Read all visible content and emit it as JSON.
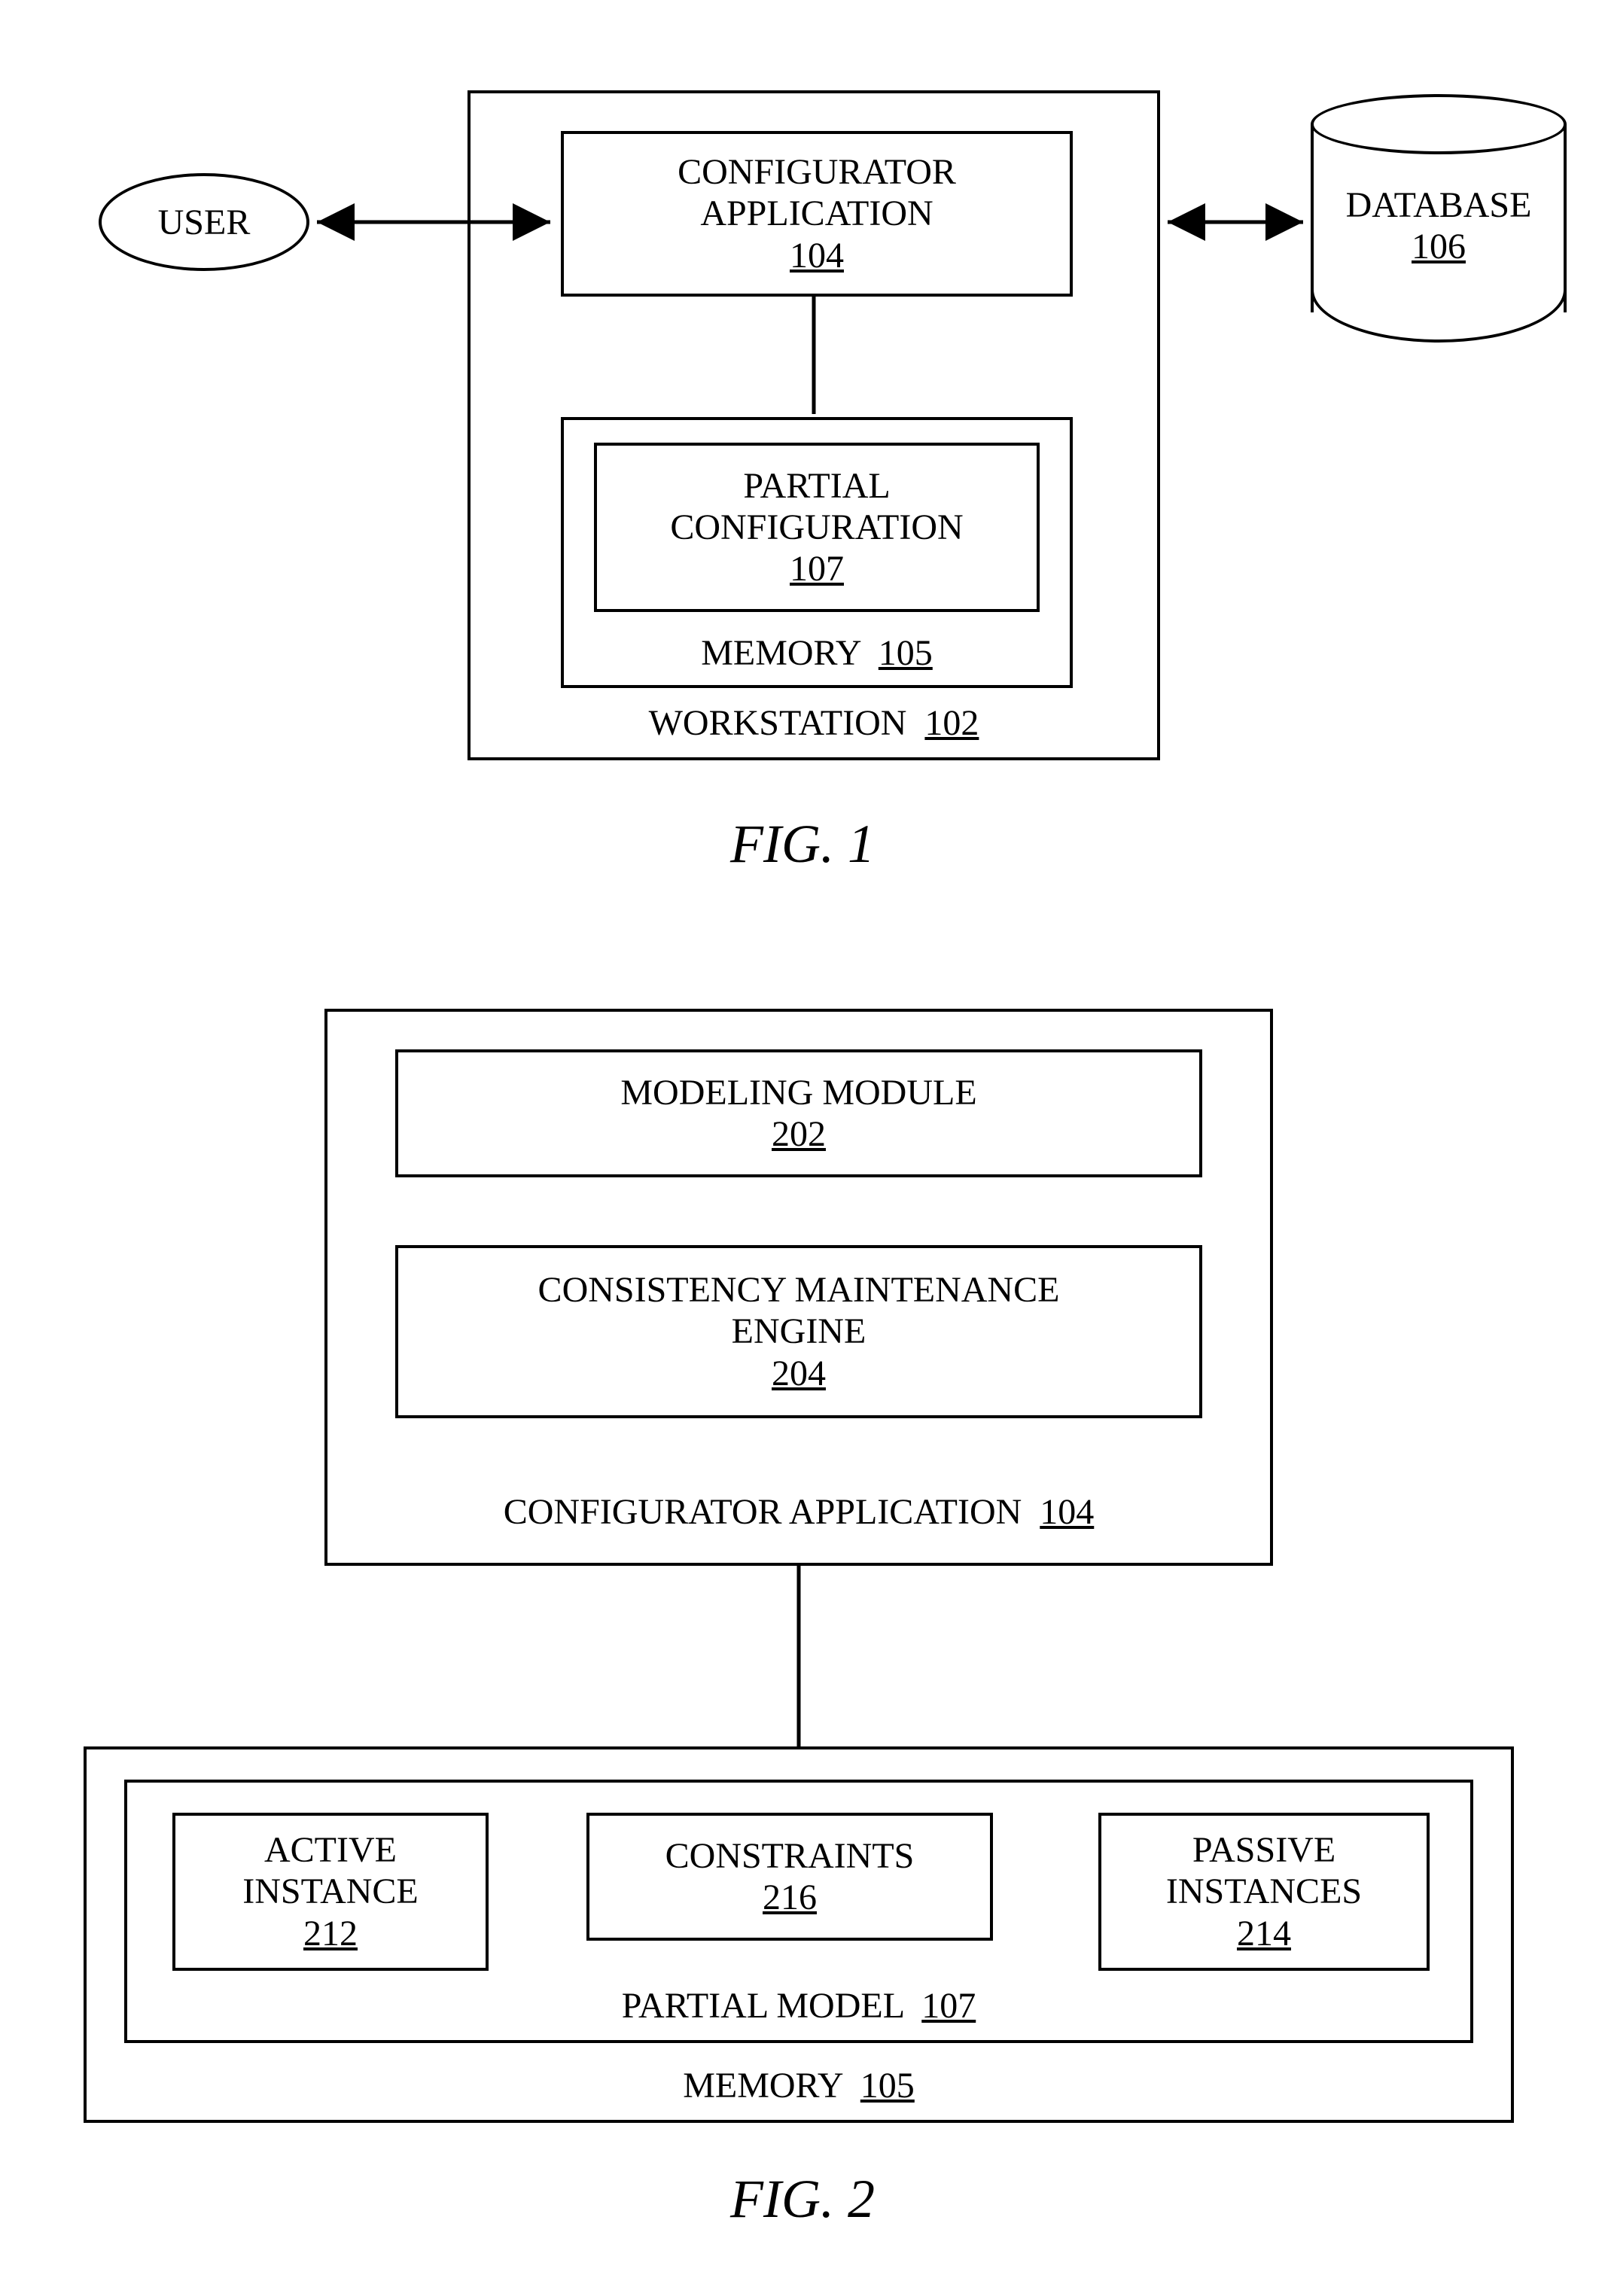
{
  "fig1": {
    "user": "USER",
    "configurator_app": "CONFIGURATOR\nAPPLICATION",
    "configurator_app_ref": "104",
    "partial_config": "PARTIAL\nCONFIGURATION",
    "partial_config_ref": "107",
    "memory_label": "MEMORY",
    "memory_ref": "105",
    "workstation_label": "WORKSTATION",
    "workstation_ref": "102",
    "database": "DATABASE",
    "database_ref": "106",
    "caption": "FIG. 1"
  },
  "fig2": {
    "modeling_module": "MODELING MODULE",
    "modeling_module_ref": "202",
    "consistency_engine": "CONSISTENCY MAINTENANCE\nENGINE",
    "consistency_engine_ref": "204",
    "configurator_app_label": "CONFIGURATOR APPLICATION",
    "configurator_app_ref": "104",
    "active_instance": "ACTIVE\nINSTANCE",
    "active_instance_ref": "212",
    "constraints": "CONSTRAINTS",
    "constraints_ref": "216",
    "passive_instances": "PASSIVE\nINSTANCES",
    "passive_instances_ref": "214",
    "partial_model_label": "PARTIAL MODEL",
    "partial_model_ref": "107",
    "memory_label": "MEMORY",
    "memory_ref": "105",
    "caption": "FIG. 2"
  }
}
